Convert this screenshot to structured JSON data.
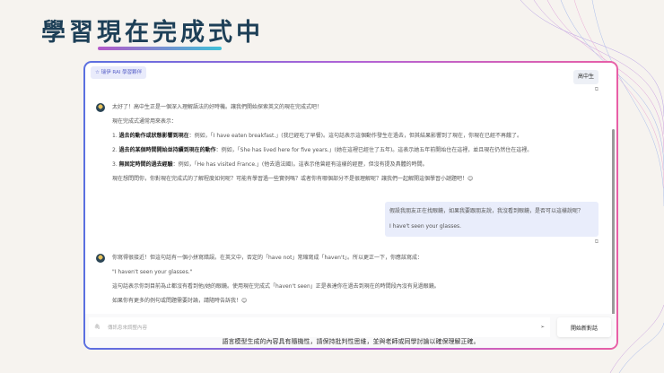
{
  "page_title": "學習現在完成式中",
  "header": {
    "tag": "瑞伊 RAI 學習夥伴",
    "user_label": "高中生"
  },
  "messages": {
    "bot1": {
      "intro": "太好了！高中生正是一個深入理解語法的好時機。讓我們開始探索英文的現在完成式吧！",
      "lead": "現在完成式通常用來表示：",
      "items": [
        {
          "num": "1.",
          "bold": "過去的動作或狀態影響到現在",
          "text": "：例如，「I have eaten breakfast.」(我已經吃了早餐)。這句話表示這個動作發生在過去，但其結果影響到了現在，你現在已經不再餓了。"
        },
        {
          "num": "2.",
          "bold": "過去的某個時間開始並持續到現在的動作",
          "text": "：例如，「She has lived here for five years.」(她在這裡已經住了五年)。這表示她五年前開始住在這裡，並且現在仍然住在這裡。"
        },
        {
          "num": "3.",
          "bold": "無固定時間的過去經驗",
          "text": "：例如，「He has visited France.」(他去過法國)。這表示他曾經有這樣的經歷，但沒有提及具體的時間。"
        }
      ],
      "outro": "現在想問問你，你對現在完成式的了解程度如何呢？可能有學習過一些實例嗎？或者你有哪個部分不是很理解呢？讓我們一起解開這個學習小謎題吧！😊"
    },
    "user1": {
      "question": "假設我朋友正在找眼鏡，如果我要跟朋友說，我沒看到眼鏡，是否可以這樣說呢？",
      "sentence": "I have't seen your glasses."
    },
    "bot2": {
      "p1": "你寫得很接近！但這句話有一個小拼寫錯誤。在英文中，否定的「have not」常縮寫成「haven't」。所以更正一下，你應該寫成：",
      "p2": "\"I haven't seen your glasses.\"",
      "p3": "這句話表示你到目前為止都沒有看到他/她的眼鏡。使用現在完成式「haven't seen」正是表達你在過去到現在的時間段內沒有見過眼鏡。",
      "p4": "如果你有更多的例句或問題需要討論，請隨時告訴我！😊"
    }
  },
  "input": {
    "placeholder": "傳訊息來調整內容"
  },
  "buttons": {
    "new_chat": "開始新對話"
  },
  "disclaimer": "語言模型生成的內容具有隨機性，請保持批判性思維，並與老師或同學討論以確保理解正確。"
}
